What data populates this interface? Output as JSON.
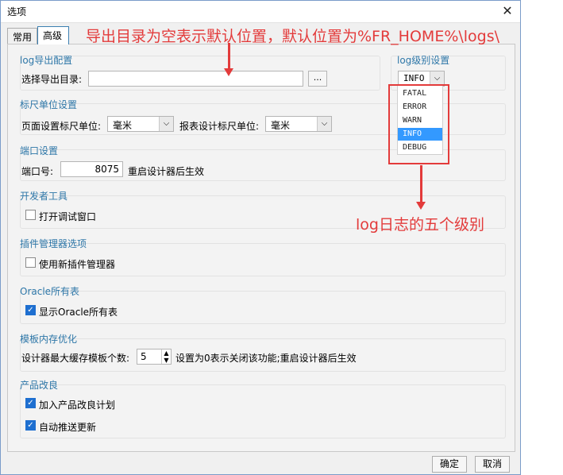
{
  "window": {
    "title": "选项",
    "close_glyph": "✕"
  },
  "tabs": [
    {
      "label": "常用"
    },
    {
      "label": "高级"
    }
  ],
  "annotation_top": "导出目录为空表示默认位置，默认位置为%FR_HOME%\\logs\\",
  "annotation_bottom": "log日志的五个级别",
  "log_export": {
    "title": "log导出配置",
    "select_label": "选择导出目录:",
    "browse_label": "...",
    "path_value": ""
  },
  "log_level": {
    "title": "log级别设置",
    "value": "INFO",
    "options": [
      "FATAL",
      "ERROR",
      "WARN",
      "INFO",
      "DEBUG"
    ],
    "selected_index": 3
  },
  "ruler": {
    "title": "标尺单位设置",
    "page_label": "页面设置标尺单位:",
    "page_value": "毫米",
    "report_label": "报表设计标尺单位:",
    "report_value": "毫米"
  },
  "port": {
    "title": "端口设置",
    "label": "端口号:",
    "value": "8075",
    "hint": "重启设计器后生效"
  },
  "devtools": {
    "title": "开发者工具",
    "checkbox_label": "打开调试窗口",
    "checked": false
  },
  "plugin": {
    "title": "插件管理器选项",
    "checkbox_label": "使用新插件管理器",
    "checked": false
  },
  "oracle": {
    "title": "Oracle所有表",
    "checkbox_label": "显示Oracle所有表",
    "checked": true
  },
  "cache": {
    "title": "模板内存优化",
    "label": "设计器最大缓存模板个数:",
    "value": "5",
    "hint": "设置为0表示关闭该功能;重启设计器后生效"
  },
  "improve": {
    "title": "产品改良",
    "items": [
      {
        "label": "加入产品改良计划",
        "checked": true
      },
      {
        "label": "自动推送更新",
        "checked": true
      }
    ]
  },
  "footer": {
    "ok_label": "确定",
    "cancel_label": "取消"
  },
  "colors": {
    "accent_red": "#e33b3b",
    "group_title": "#2e77a8",
    "checkbox_checked": "#1e6fd0",
    "selected_item": "#3399ff"
  }
}
